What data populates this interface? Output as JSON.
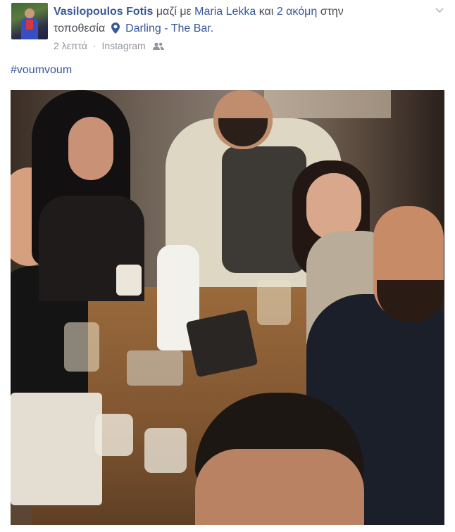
{
  "post": {
    "author": "Vasilopoulos Fotis",
    "with_text": "μαζί με",
    "tagged_person": "Maria Lekka",
    "and_text": "και",
    "others_link": "2 ακόμη",
    "location_prefix_line1": "στην",
    "location_prefix_line2": "τοποθεσία",
    "location_name": "Darling - The Bar.",
    "time": "2 λεπτά",
    "dot": "·",
    "source": "Instagram",
    "audience_icon": "friends-icon",
    "hashtag": "#voumvoum"
  },
  "icons": {
    "location": "map-pin-icon",
    "menu": "chevron-down-icon"
  },
  "colors": {
    "link": "#365899",
    "text": "#4b4f56",
    "meta": "#90949c"
  }
}
